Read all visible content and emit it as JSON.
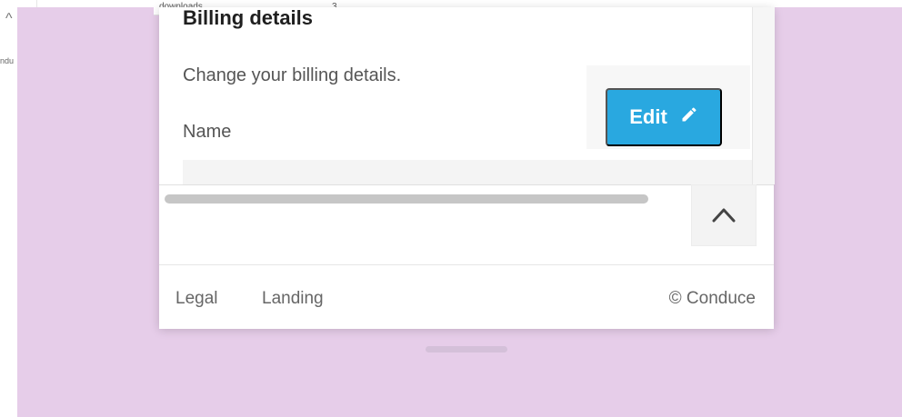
{
  "background": {
    "left_label": "ndu",
    "top_strip": {
      "downloads_label": "downloads",
      "number_label": "3"
    }
  },
  "card": {
    "section_title": "Billing details",
    "section_subtitle": "Change your billing details.",
    "field_name_label": "Name",
    "edit_button_label": "Edit"
  },
  "footer": {
    "links": [
      "Legal",
      "Landing"
    ],
    "copyright": "© Conduce"
  },
  "colors": {
    "canvas_bg": "#e6cde9",
    "accent_button": "#29a8e0"
  },
  "icons": {
    "edit": "pencil-icon",
    "scroll_top": "chevron-up-icon",
    "left_chevron": "chevron-up-icon"
  }
}
